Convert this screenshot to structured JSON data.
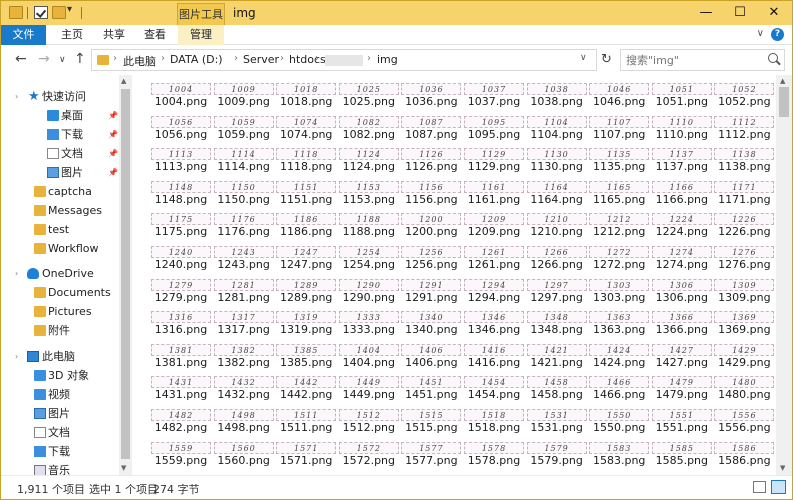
{
  "window": {
    "title": "img",
    "context_tab": "图片工具",
    "controls": {
      "minimize": "—",
      "maximize": "☐",
      "close": "✕"
    }
  },
  "ribbon": {
    "tabs": [
      "文件",
      "主页",
      "共享",
      "查看",
      "管理"
    ],
    "toggle": "∨",
    "help": "?"
  },
  "nav": {
    "back": "←",
    "forward": "→",
    "recent": "∨",
    "up": "↑",
    "refresh": "↻",
    "breadcrumb": [
      "此电脑",
      "DATA (D:)",
      "Server",
      "htdocs",
      "img"
    ],
    "search_placeholder": "搜索\"img\""
  },
  "sidebar": {
    "items": [
      {
        "label": "快速访问",
        "icon": "star-icon"
      },
      {
        "label": "桌面",
        "icon": "desktop-icon",
        "pinned": true
      },
      {
        "label": "下载",
        "icon": "download-icon",
        "pinned": true
      },
      {
        "label": "文档",
        "icon": "document-icon",
        "pinned": true
      },
      {
        "label": "图片",
        "icon": "pictures-icon",
        "pinned": true
      },
      {
        "label": "captcha",
        "icon": "folder-icon"
      },
      {
        "label": "Messages",
        "icon": "folder-icon"
      },
      {
        "label": "test",
        "icon": "folder-icon"
      },
      {
        "label": "Workflow",
        "icon": "folder-icon"
      },
      {
        "label": "OneDrive",
        "icon": "cloud-icon"
      },
      {
        "label": "Documents",
        "icon": "folder-icon"
      },
      {
        "label": "Pictures",
        "icon": "folder-icon"
      },
      {
        "label": "附件",
        "icon": "folder-icon"
      },
      {
        "label": "此电脑",
        "icon": "computer-icon"
      },
      {
        "label": "3D 对象",
        "icon": "3d-objects-icon"
      },
      {
        "label": "视频",
        "icon": "video-icon"
      },
      {
        "label": "图片",
        "icon": "pictures-icon"
      },
      {
        "label": "文档",
        "icon": "document-icon"
      },
      {
        "label": "下载",
        "icon": "download-icon"
      },
      {
        "label": "音乐",
        "icon": "music-icon"
      }
    ]
  },
  "files": [
    "1004",
    "1009",
    "1018",
    "1025",
    "1036",
    "1037",
    "1038",
    "1046",
    "1051",
    "1052",
    "1056",
    "1059",
    "1074",
    "1082",
    "1087",
    "1095",
    "1104",
    "1107",
    "1110",
    "1112",
    "1113",
    "1114",
    "1118",
    "1124",
    "1126",
    "1129",
    "1130",
    "1135",
    "1137",
    "1138",
    "1148",
    "1150",
    "1151",
    "1153",
    "1156",
    "1161",
    "1164",
    "1165",
    "1166",
    "1171",
    "1175",
    "1176",
    "1186",
    "1188",
    "1200",
    "1209",
    "1210",
    "1212",
    "1224",
    "1226",
    "1240",
    "1243",
    "1247",
    "1254",
    "1256",
    "1261",
    "1266",
    "1272",
    "1274",
    "1276",
    "1279",
    "1281",
    "1289",
    "1290",
    "1291",
    "1294",
    "1297",
    "1303",
    "1306",
    "1309",
    "1316",
    "1317",
    "1319",
    "1333",
    "1340",
    "1346",
    "1348",
    "1363",
    "1366",
    "1369",
    "1381",
    "1382",
    "1385",
    "1404",
    "1406",
    "1416",
    "1421",
    "1424",
    "1427",
    "1429",
    "1431",
    "1432",
    "1442",
    "1449",
    "1451",
    "1454",
    "1458",
    "1466",
    "1479",
    "1480",
    "1482",
    "1498",
    "1511",
    "1512",
    "1515",
    "1518",
    "1531",
    "1550",
    "1551",
    "1556",
    "1559",
    "1560",
    "1571",
    "1572",
    "1577",
    "1578",
    "1579",
    "1583",
    "1585",
    "1586"
  ],
  "file_ext": ".png",
  "status": {
    "count": "1,911 个项目",
    "selected": "选中 1 个项目",
    "size": "274 字节"
  }
}
